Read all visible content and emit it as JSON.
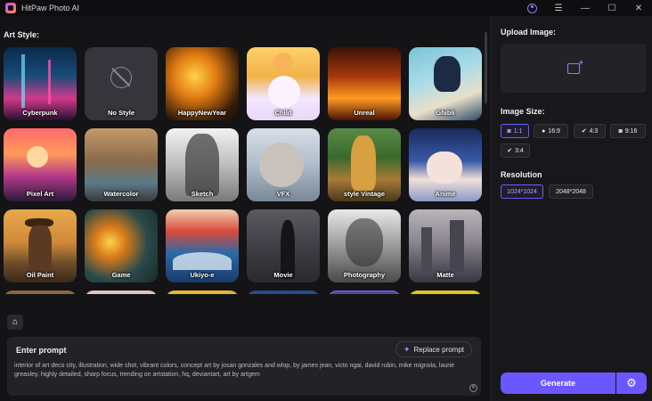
{
  "app": {
    "title": "HitPaw Photo AI"
  },
  "left": {
    "art_style_title": "Art Style:",
    "styles": [
      {
        "label": "Cyberpunk"
      },
      {
        "label": "No Style"
      },
      {
        "label": "HappyNewYear"
      },
      {
        "label": "Child"
      },
      {
        "label": "Unreal"
      },
      {
        "label": "Ghibli"
      },
      {
        "label": "Pixel Art"
      },
      {
        "label": "Watercolor"
      },
      {
        "label": "Sketch"
      },
      {
        "label": "VFX"
      },
      {
        "label": "style Vintage"
      },
      {
        "label": "Anime"
      },
      {
        "label": "Oil Paint"
      },
      {
        "label": "Game"
      },
      {
        "label": "Ukiyo-e"
      },
      {
        "label": "Movie"
      },
      {
        "label": "Photography"
      },
      {
        "label": "Matte"
      }
    ]
  },
  "prompt": {
    "title": "Enter prompt",
    "replace_label": "Replace prompt",
    "text": "interior of art deco city, illustration, wide shot, vibrant colors, concept art by josan gonzales and wlop, by james jean, victo ngai, david rubin, mike mignola, laurie greasley, highly detailed, sharp focus, trending on artstation, hq, deviantart, art by artgem"
  },
  "right": {
    "upload_title": "Upload Image:",
    "size_title": "Image Size:",
    "sizes": [
      {
        "label": "1:1",
        "icon": "instagram-icon",
        "selected": true
      },
      {
        "label": "16:9",
        "icon": "facebook-icon",
        "selected": false
      },
      {
        "label": "4:3",
        "icon": "twitter-icon",
        "selected": false
      },
      {
        "label": "9:16",
        "icon": "instagram-icon",
        "selected": false
      },
      {
        "label": "3:4",
        "icon": "twitter-icon",
        "selected": false
      }
    ],
    "resolution_title": "Resolution",
    "resolutions": [
      {
        "label": "1024*1024",
        "selected": true
      },
      {
        "label": "2048*2048",
        "selected": false
      }
    ],
    "generate_label": "Generate"
  },
  "colors": {
    "accent": "#6b57ff",
    "bg": "#141416",
    "panel": "#18181b"
  }
}
